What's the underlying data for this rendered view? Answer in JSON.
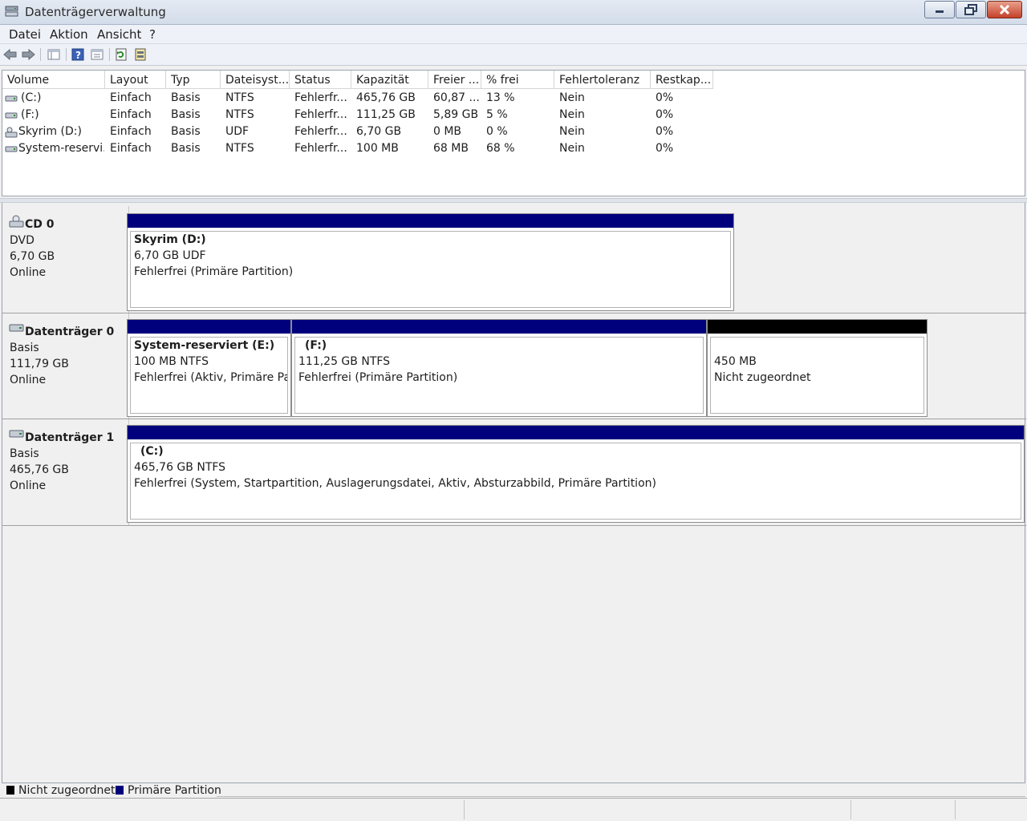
{
  "window": {
    "title": "Datenträgerverwaltung",
    "icon": "disk-management-icon"
  },
  "menu": [
    "Datei",
    "Aktion",
    "Ansicht",
    "?"
  ],
  "toolbar": {
    "icons": [
      "back-arrow-icon",
      "forward-arrow-icon",
      "console-tree-icon",
      "help-icon",
      "properties-icon",
      "refresh-icon",
      "rescan-disks-icon"
    ]
  },
  "volume_list": {
    "columns": [
      "Volume",
      "Layout",
      "Typ",
      "Dateisyst...",
      "Status",
      "Kapazität",
      "Freier ...",
      "% frei",
      "Fehlertoleranz",
      "Restkap..."
    ],
    "rows": [
      {
        "volume": "(C:)",
        "layout": "Einfach",
        "typ": "Basis",
        "fs": "NTFS",
        "status": "Fehlerfr...",
        "kap": "465,76 GB",
        "frei": "60,87 ...",
        "pct": "13 %",
        "ft": "Nein",
        "rest": "0%"
      },
      {
        "volume": "(F:)",
        "layout": "Einfach",
        "typ": "Basis",
        "fs": "NTFS",
        "status": "Fehlerfr...",
        "kap": "111,25 GB",
        "frei": "5,89 GB",
        "pct": "5 %",
        "ft": "Nein",
        "rest": "0%"
      },
      {
        "volume": "Skyrim (D:)",
        "layout": "Einfach",
        "typ": "Basis",
        "fs": "UDF",
        "status": "Fehlerfr...",
        "kap": "6,70 GB",
        "frei": "0 MB",
        "pct": "0 %",
        "ft": "Nein",
        "rest": "0%"
      },
      {
        "volume": "System-reservi...",
        "layout": "Einfach",
        "typ": "Basis",
        "fs": "NTFS",
        "status": "Fehlerfr...",
        "kap": "100 MB",
        "frei": "68 MB",
        "pct": "68 %",
        "ft": "Nein",
        "rest": "0%"
      }
    ]
  },
  "disks": [
    {
      "name": "CD 0",
      "type": "DVD",
      "size": "6,70 GB",
      "state": "Online",
      "partitions": [
        {
          "title": "Skyrim  (D:)",
          "line2": "6,70 GB UDF",
          "line3": "Fehlerfrei (Primäre Partition)"
        }
      ]
    },
    {
      "name": "Datenträger 0",
      "type": "Basis",
      "size": "111,79 GB",
      "state": "Online",
      "partitions": [
        {
          "title": "System-reserviert  (E:)",
          "line2": "100 MB NTFS",
          "line3": "Fehlerfrei (Aktiv, Primäre Partition)"
        },
        {
          "title": "(F:)",
          "line2": "111,25 GB NTFS",
          "line3": "Fehlerfrei (Primäre Partition)"
        },
        {
          "title": "",
          "line2": "450 MB",
          "line3": "Nicht zugeordnet"
        }
      ]
    },
    {
      "name": "Datenträger 1",
      "type": "Basis",
      "size": "465,76 GB",
      "state": "Online",
      "partitions": [
        {
          "title": "(C:)",
          "line2": "465,76 GB NTFS",
          "line3": "Fehlerfrei (System, Startpartition, Auslagerungsdatei, Aktiv, Absturzabbild, Primäre Partition)"
        }
      ]
    }
  ],
  "legend": {
    "items": [
      {
        "label": "Nicht zugeordnet",
        "color": "#000000"
      },
      {
        "label": "Primäre Partition",
        "color": "#00007d"
      }
    ]
  }
}
